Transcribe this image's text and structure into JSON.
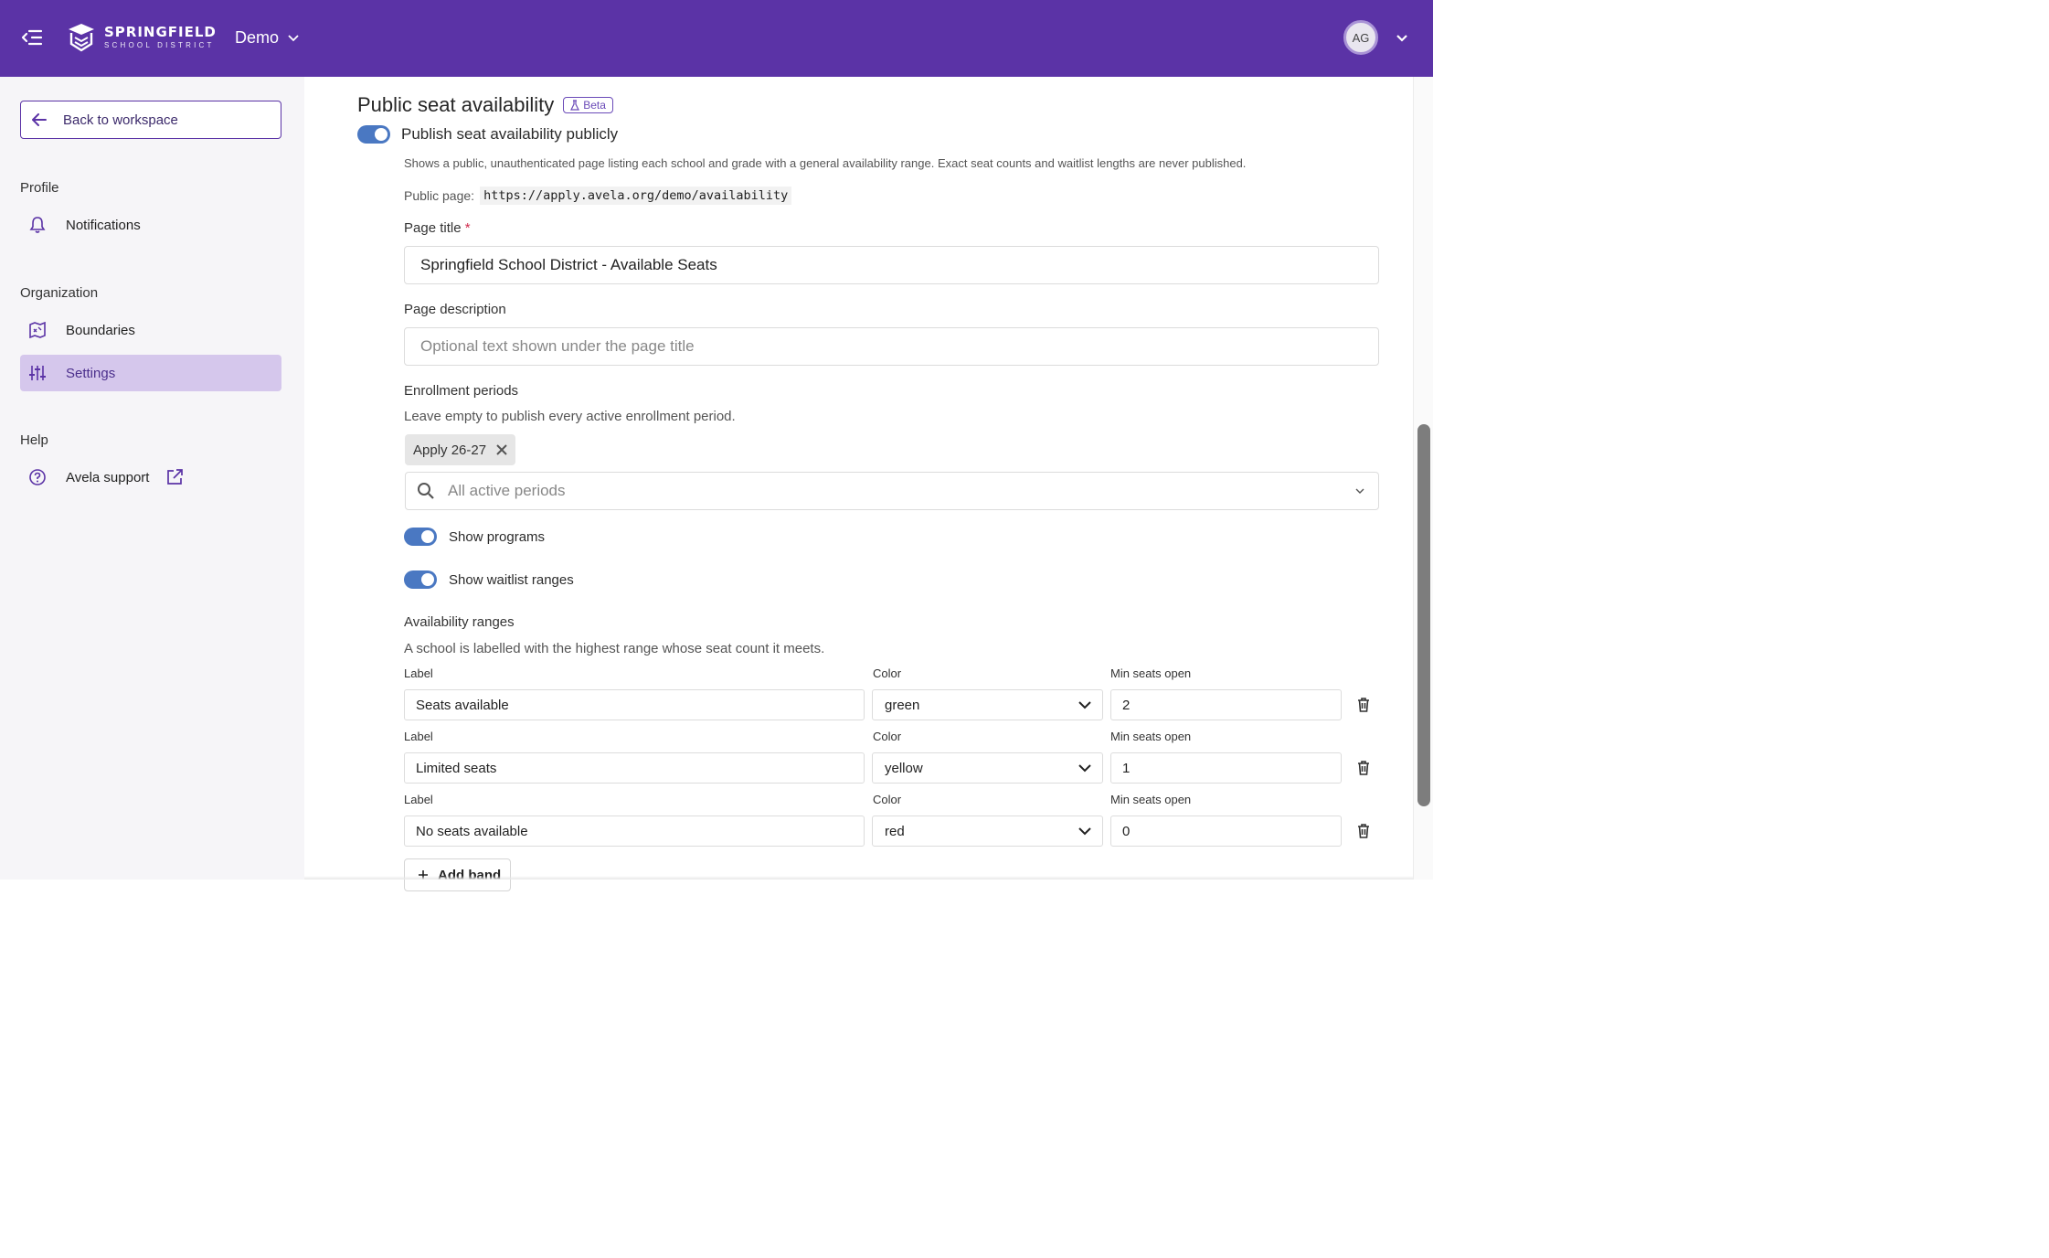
{
  "header": {
    "brand_name": "SPRINGFIELD",
    "brand_sub": "SCHOOL DISTRICT",
    "org_name": "Demo",
    "user_initials": "AG"
  },
  "sidebar": {
    "back_label": "Back to workspace",
    "sections": {
      "profile": "Profile",
      "organization": "Organization",
      "help": "Help"
    },
    "items": {
      "notifications": "Notifications",
      "boundaries": "Boundaries",
      "settings": "Settings",
      "support": "Avela support"
    }
  },
  "main": {
    "title": "Public seat availability",
    "beta": "Beta",
    "publish_label": "Publish seat availability publicly",
    "publish_enabled": true,
    "publish_help": "Shows a public, unauthenticated page listing each school and grade with a general availability range. Exact seat counts and waitlist lengths are never published.",
    "public_page_label": "Public page:",
    "public_page_url": "https://apply.avela.org/demo/availability",
    "page_title_label": "Page title",
    "page_title_required": "*",
    "page_title_value": "Springfield School District - Available Seats",
    "page_description_label": "Page description",
    "page_description_placeholder": "Optional text shown under the page title",
    "enrollment_label": "Enrollment periods",
    "enrollment_help": "Leave empty to publish every active enrollment period.",
    "enrollment_chip": "Apply 26-27",
    "enrollment_placeholder": "All active periods",
    "show_programs_label": "Show programs",
    "show_programs_enabled": true,
    "show_waitlist_label": "Show waitlist ranges",
    "show_waitlist_enabled": true,
    "ranges_label": "Availability ranges",
    "ranges_help": "A school is labelled with the highest range whose seat count it meets.",
    "band_headers": {
      "label": "Label",
      "color": "Color",
      "min": "Min seats open"
    },
    "bands": [
      {
        "label": "Seats available",
        "color": "green",
        "min": "2"
      },
      {
        "label": "Limited seats",
        "color": "yellow",
        "min": "1"
      },
      {
        "label": "No seats available",
        "color": "red",
        "min": "0"
      }
    ],
    "add_band_label": "Add band"
  },
  "colors": {
    "brand": "#5b33a6",
    "active_nav": "#d5c7ec",
    "toggle_on": "#4a78c2"
  }
}
